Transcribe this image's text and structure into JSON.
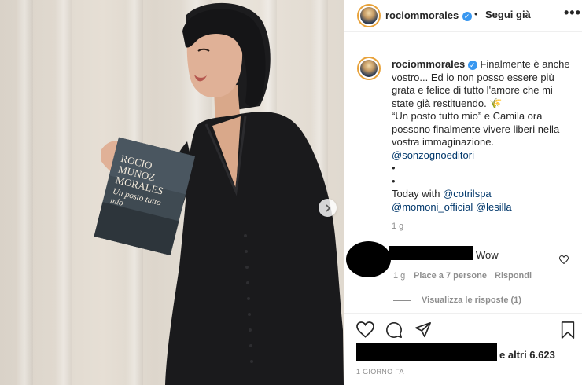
{
  "post": {
    "username": "rociommorales",
    "verified": true,
    "follow_status": "Segui già",
    "separator": "•",
    "more_label": "•••"
  },
  "book": {
    "title_line1": "ROCIO",
    "title_line2": "MUNOZ",
    "title_line3": "MORALES",
    "subtitle": "Un posto tutto mio"
  },
  "caption": {
    "lines": [
      "Finalmente è anche",
      "vostro... Ed io non posso essere più",
      "grata e felice di tutto l'amore che mi",
      "state già restituendo. 🌾",
      "“Un posto tutto mio” e Camila ora",
      "possono finalmente vivere liberi nella",
      "vostra immaginazione.",
      "@sonzognoeditori",
      "•",
      "•",
      "Today with @cotrilspa",
      "@momoni_official @lesilla"
    ],
    "line1_first": "Finalmente è anche",
    "line2": "vostro... Ed io non posso essere più",
    "line3": "grata e felice di tutto l'amore che mi",
    "line4": "state già restituendo. 🌾",
    "line5": "“Un posto tutto mio” e Camila ora",
    "line6": "possono finalmente vivere liberi nella",
    "line7": "vostra immaginazione.",
    "mention_publisher": "@sonzognoeditori",
    "bullet": "•",
    "today_with": "Today with ",
    "mention_1": "@cotrilspa",
    "mention_2": "@momoni_official",
    "mention_3": "@lesilla",
    "time": "1 g"
  },
  "comment": {
    "text": "Wow",
    "time": "1 g",
    "likes": "Piace a 7 persone",
    "reply": "Rispondi",
    "view_replies": "Visualizza le risposte (1)"
  },
  "footer": {
    "likes_text": "e altri 6.623",
    "date": "1 GIORNO FA"
  },
  "icons": [
    "verified-badge-icon",
    "more-icon",
    "next-arrow-icon",
    "heart-icon",
    "comment-icon",
    "share-icon",
    "bookmark-icon",
    "small-heart-icon"
  ],
  "colors": {
    "link": "#00376b",
    "verified": "#3897f0",
    "secondary": "#8e8e8e",
    "story_ring": "#e8a23a"
  }
}
